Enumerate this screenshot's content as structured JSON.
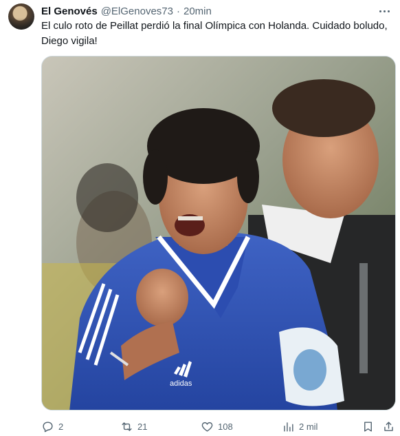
{
  "tweet": {
    "author_name": "El Genovés",
    "author_handle": "@ElGenoves73",
    "separator": "·",
    "time": "20min",
    "text": "El culo roto de Peillat perdió la final Olímpica con Holanda. Cuidado boludo, Diego vigila!"
  },
  "media": {
    "description_icon": "photo",
    "shirt_logo_text": "adidas"
  },
  "actions": {
    "reply_count": "2",
    "retweet_count": "21",
    "like_count": "108",
    "views_count": "2 mil"
  },
  "colors": {
    "text_primary": "#0f1419",
    "text_secondary": "#536471",
    "border": "#cfd9de"
  }
}
